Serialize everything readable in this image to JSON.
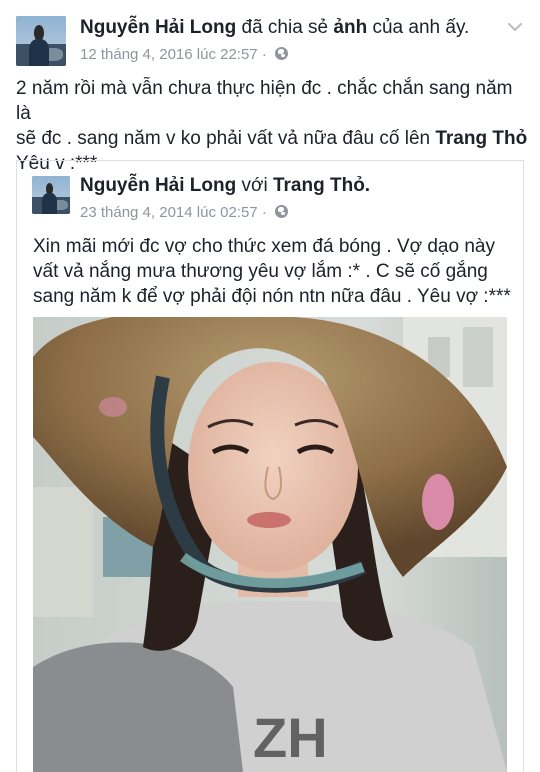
{
  "post": {
    "author": "Nguyễn Hải Long",
    "action": "đã chia sẻ",
    "action_object": "ảnh",
    "action_suffix": "của anh ấy.",
    "timestamp": "12 tháng 4, 2016 lúc 22:57",
    "privacy_icon": "globe-icon",
    "menu_icon": "chevron-down-icon",
    "text_line1": "2 năm rồi mà vẫn chưa thực hiện đc . chắc chắn sang năm là",
    "text_line2_prefix": "sẽ đc . sang năm v ko phải vất vả nữa đâu cố lên",
    "text_mention": "Trang Thỏ",
    "text_line3": "Yêu v :***"
  },
  "shared": {
    "author": "Nguyễn Hải Long",
    "with_word": "với",
    "tagged": "Trang Thỏ.",
    "timestamp": "23 tháng 4, 2014 lúc 02:57",
    "privacy_icon": "globe-icon",
    "text_line1": "Xin mãi mới đc vợ cho thức xem đá bóng . Vợ dạo này",
    "text_line2": "vất vả nắng mưa thương yêu vợ lắm :* . C sẽ cố gắng",
    "text_line3": "sang năm k để vợ phải đội nón ntn nữa đâu . Yêu vợ :***"
  },
  "colors": {
    "text": "#1d2129",
    "meta": "#90949c",
    "border": "#dddfe2"
  }
}
